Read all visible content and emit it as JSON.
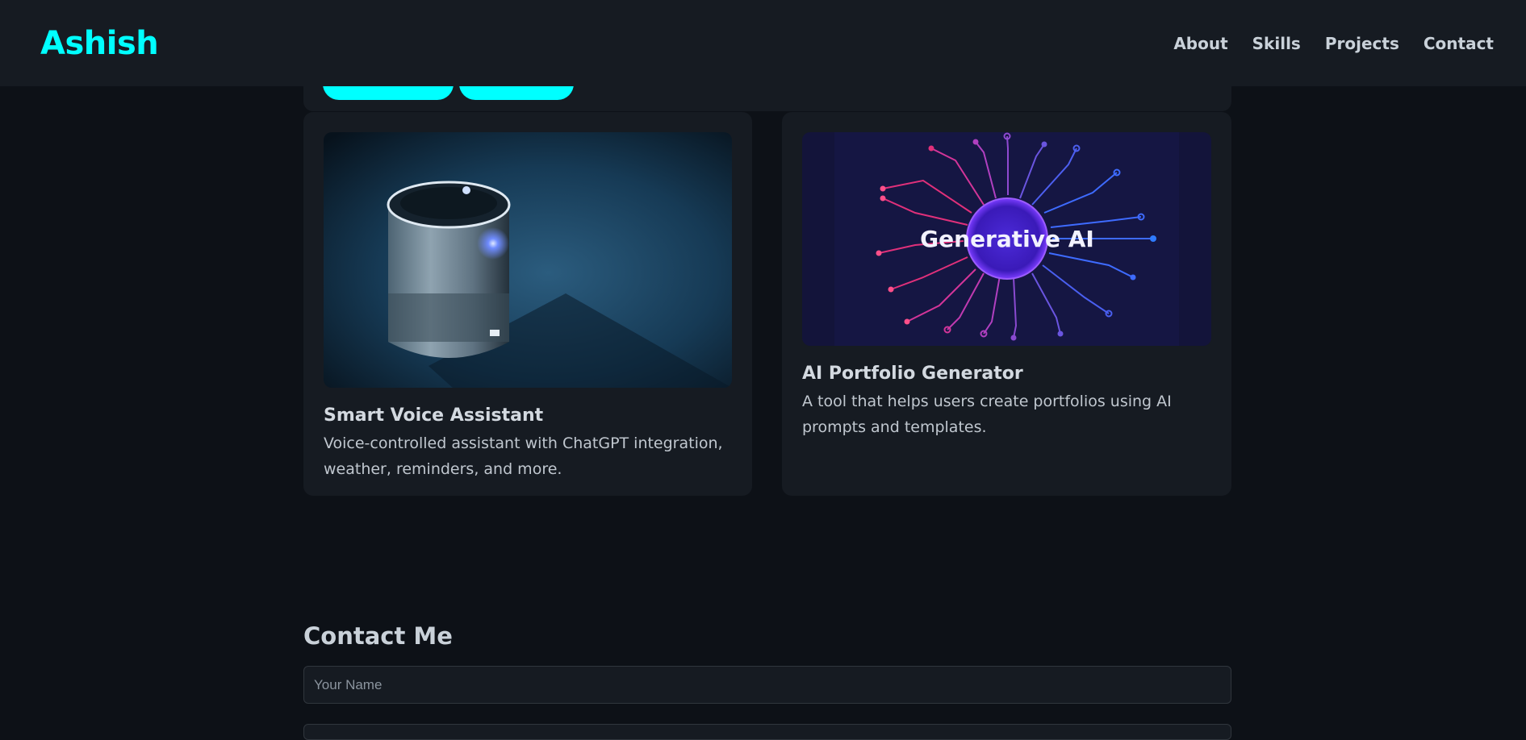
{
  "nav": {
    "logo": "Ashish",
    "links": [
      "About",
      "Skills",
      "Projects",
      "Contact"
    ]
  },
  "projects": [
    {
      "title": "Smart Voice Assistant",
      "description": "Voice-controlled assistant with ChatGPT integration, weather, reminders, and more."
    },
    {
      "title": "AI Portfolio Generator",
      "description": "A tool that helps users create portfolios using AI prompts and templates.",
      "image_text": "Generative AI"
    }
  ],
  "contact": {
    "title": "Contact Me",
    "name_placeholder": "Your Name"
  },
  "colors": {
    "accent": "#00ffff",
    "background": "#0d1117",
    "card": "#161b22"
  }
}
